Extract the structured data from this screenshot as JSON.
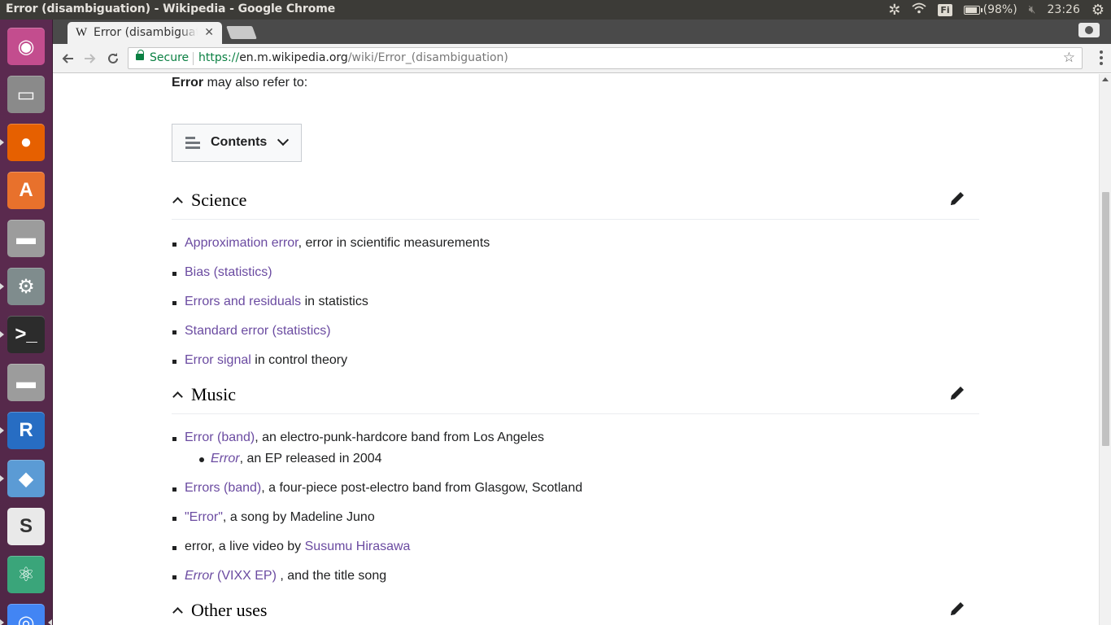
{
  "topbar": {
    "window_title": "Error (disambiguation) - Wikipedia - Google Chrome",
    "keyboard_layout": "Fi",
    "battery_text": "(98%)",
    "battery_level": 0.98,
    "clock": "23:26",
    "tray_icons": [
      "network-settings-icon",
      "wifi-icon",
      "keyboard-layout-icon",
      "battery-icon",
      "volume-muted-icon",
      "system-gear-icon"
    ]
  },
  "launcher": {
    "items": [
      {
        "name": "ubuntu-dash-icon",
        "glyph": "◉",
        "color": "#c34d8e"
      },
      {
        "name": "files-icon",
        "glyph": "▭",
        "color": "#8a8a8a"
      },
      {
        "name": "firefox-icon",
        "glyph": "●",
        "color": "#e66000"
      },
      {
        "name": "software-center-icon",
        "glyph": "A",
        "color": "#e8712c"
      },
      {
        "name": "disk-drive-icon",
        "glyph": "▬",
        "color": "#9c9c9c"
      },
      {
        "name": "system-settings-icon",
        "glyph": "⚙",
        "color": "#7f8c8d"
      },
      {
        "name": "terminal-icon",
        "glyph": ">_",
        "color": "#2c2c2c"
      },
      {
        "name": "disk-drive-2-icon",
        "glyph": "▬",
        "color": "#9c9c9c"
      },
      {
        "name": "r-language-icon",
        "glyph": "R",
        "color": "#276dc3"
      },
      {
        "name": "virtualbox-icon",
        "glyph": "◆",
        "color": "#5b9bd5"
      },
      {
        "name": "slack-icon",
        "glyph": "S",
        "color": "#e9e9e9"
      },
      {
        "name": "atom-editor-icon",
        "glyph": "⚛",
        "color": "#3aa57a"
      },
      {
        "name": "chrome-icon",
        "glyph": "◎",
        "color": "#4285f4"
      }
    ]
  },
  "browser": {
    "tab_title": "Error (disambiguation) - Wikipedia",
    "tab_favicon": "W",
    "secure_label": "Secure",
    "url_scheme": "https://",
    "url_host": "en.m.wikipedia.org",
    "url_path": "/wiki/Error_(disambiguation)",
    "accent_secure": "#0b8043"
  },
  "page": {
    "intro_bold": "Error",
    "intro_rest": " may also refer to:",
    "toc_label": "Contents",
    "sections": [
      {
        "title": "Science",
        "items": [
          {
            "link": "Approximation error",
            "text": ", error in scientific measurements"
          },
          {
            "link": "Bias (statistics)",
            "text": ""
          },
          {
            "link": "Errors and residuals",
            "text": " in statistics"
          },
          {
            "link": "Standard error (statistics)",
            "text": ""
          },
          {
            "link": "Error signal",
            "text": " in control theory"
          }
        ]
      },
      {
        "title": "Music",
        "items": [
          {
            "link": "Error (band)",
            "text": ", an electro-punk-hardcore band from Los Angeles"
          },
          {
            "link": "Error",
            "text": ", an EP released in 2004",
            "sub": true,
            "italic": true
          },
          {
            "link": "Errors (band)",
            "text": ", a four-piece post-electro band from Glasgow, Scotland"
          },
          {
            "link": "\"Error\"",
            "text": ", a song by Madeline Juno"
          },
          {
            "prefix": "error, a live video by ",
            "link": "Susumu Hirasawa",
            "text": ""
          },
          {
            "link_italic": "Error",
            "link": " (VIXX EP)",
            "text": " , and the title song"
          }
        ]
      },
      {
        "title": "Other uses",
        "items": []
      }
    ],
    "link_color": "#6b4ba1"
  }
}
